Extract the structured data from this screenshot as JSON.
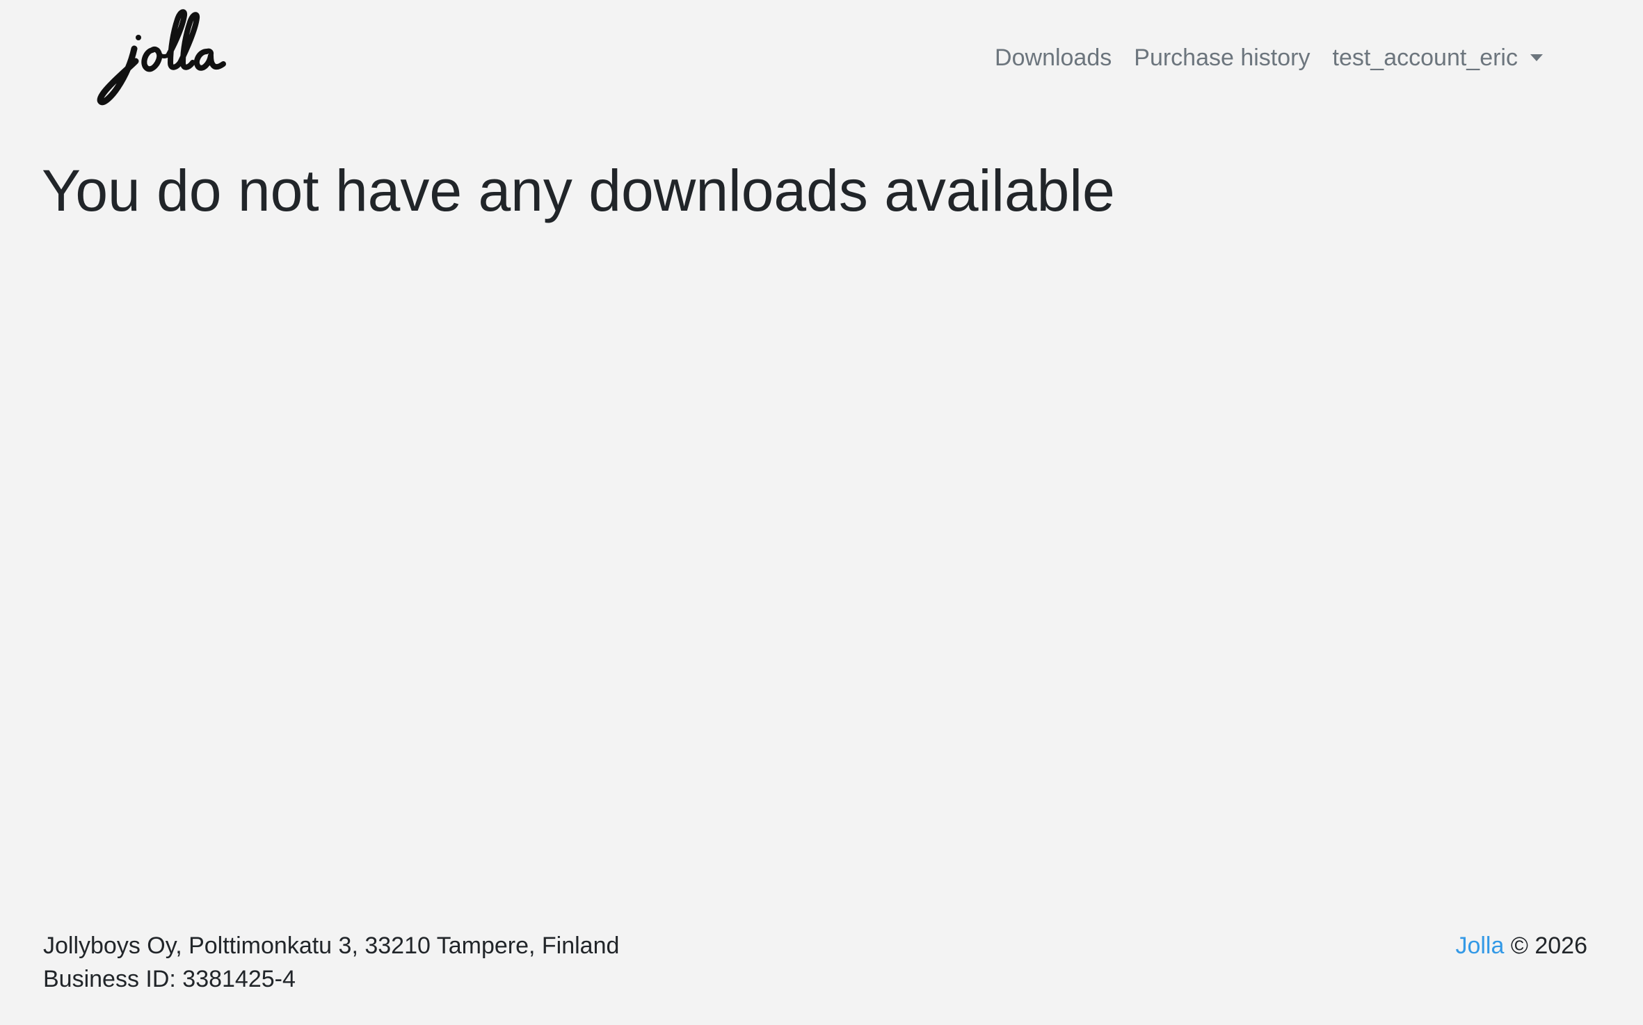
{
  "header": {
    "brand": {
      "logo_text": "jolla",
      "logo_icon": "jolla-script-logo"
    },
    "nav": {
      "downloads_label": "Downloads",
      "purchase_history_label": "Purchase history",
      "account_label": "test_account_eric",
      "account_icon": "caret-down-icon"
    }
  },
  "main": {
    "headline": "You do not have any downloads available"
  },
  "footer": {
    "address_line": "Jollyboys Oy, Polttimonkatu 3, 33210 Tampere, Finland",
    "business_id_line": "Business ID: 3381425-4",
    "company_link_label": "Jolla",
    "copyright_text": "© 2026"
  },
  "colors": {
    "background": "#f3f3f3",
    "text": "#212529",
    "muted_nav": "#6c757d",
    "link": "#3399e6"
  }
}
